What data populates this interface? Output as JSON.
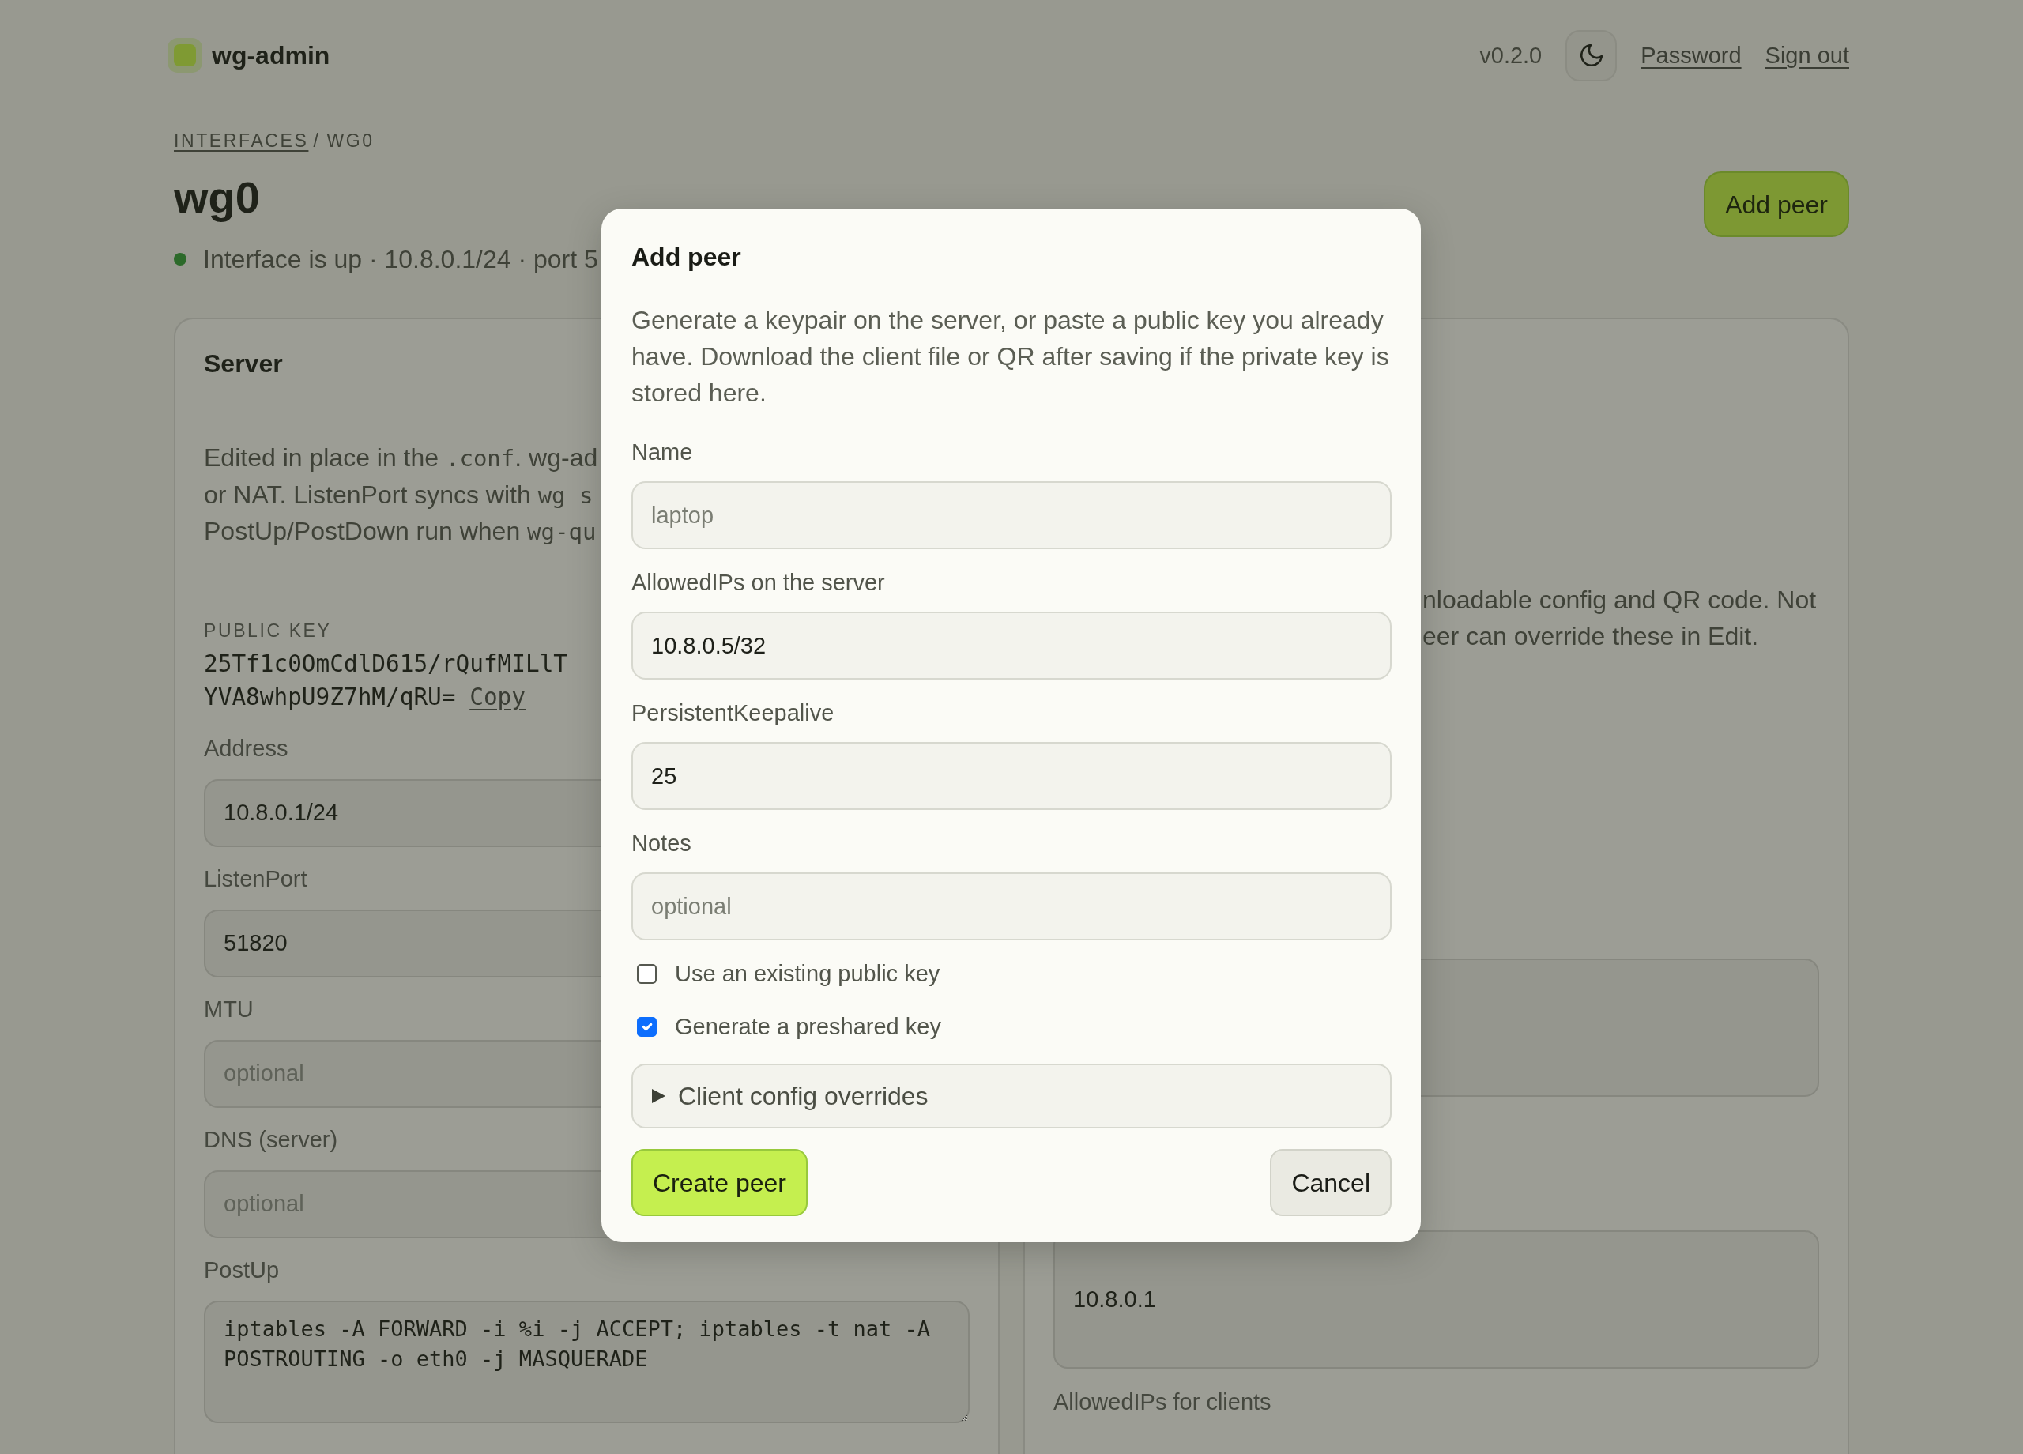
{
  "header": {
    "app_name": "wg-admin",
    "version": "v0.2.0",
    "links": [
      "Password",
      "Sign out"
    ]
  },
  "breadcrumb": {
    "items": [
      {
        "label": "INTERFACES",
        "kind": "link"
      },
      {
        "label": "WG0",
        "kind": "current"
      }
    ],
    "separator": "/"
  },
  "page": {
    "title": "wg0",
    "action": "Add peer",
    "status": {
      "up": true,
      "text": "Interface is up · 10.8.0.1/24 · port 5"
    }
  },
  "server_card": {
    "title": "Server",
    "description_lines": [
      [
        {
          "kind": "text",
          "text": "Edited in place in the "
        },
        {
          "kind": "code",
          "text": ".conf"
        },
        {
          "kind": "text",
          "text": ". wg-ad"
        }
      ],
      [
        {
          "kind": "text",
          "text": "or NAT. ListenPort syncs with "
        },
        {
          "kind": "code",
          "text": "wg s"
        }
      ],
      [
        {
          "kind": "text",
          "text": "PostUp/PostDown run when "
        },
        {
          "kind": "code",
          "text": "wg-qu"
        }
      ]
    ],
    "public_key": {
      "label": "PUBLIC KEY",
      "value": "25Tf1c0OmCdlD615/rQufMILlTYVA8whpU9Z7hM/qRU=",
      "action": "Copy"
    },
    "fields": [
      {
        "label": "Address",
        "kind": "input",
        "value": "10.8.0.1/24"
      },
      {
        "label": "ListenPort",
        "kind": "input",
        "value": "51820"
      },
      {
        "label": "MTU",
        "kind": "input",
        "placeholder": "optional"
      },
      {
        "label": "DNS (server)",
        "kind": "input",
        "placeholder": "optional"
      },
      {
        "label": "PostUp",
        "kind": "textarea",
        "value": "iptables -A FORWARD -i %i -j ACCEPT; iptables -t nat -A POSTROUTING -o eth0 -j MASQUERADE"
      }
    ]
  },
  "client_card": {
    "description_lines": [
      "nloadable config and QR code. Not",
      "eer can override these in Edit."
    ],
    "fields": [
      {
        "kind": "tall"
      },
      {
        "kind": "tall",
        "value": "10.8.0.1"
      }
    ],
    "next_label": "AllowedIPs for clients"
  },
  "dialog": {
    "title": "Add peer",
    "description": "Generate a keypair on the server, or paste a public key you already have. Download the client file or QR after saving if the private key is stored here.",
    "fields": [
      {
        "label": "Name",
        "placeholder": "laptop"
      },
      {
        "label": "AllowedIPs on the server",
        "value": "10.8.0.5/32"
      },
      {
        "label": "PersistentKeepalive",
        "value": "25"
      },
      {
        "label": "Notes",
        "placeholder": "optional"
      }
    ],
    "options": [
      {
        "label": "Use an existing public key",
        "checked": false
      },
      {
        "label": "Generate a preshared key",
        "checked": true
      }
    ],
    "overrides": {
      "label": "Client config overrides",
      "expanded": false
    },
    "buttons": [
      {
        "label": "Create peer",
        "kind": "primary"
      },
      {
        "label": "Cancel",
        "kind": "secondary"
      }
    ]
  }
}
